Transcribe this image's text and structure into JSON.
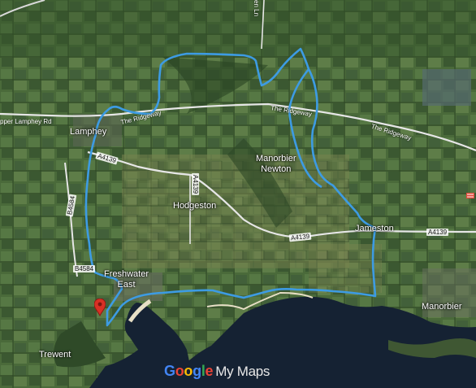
{
  "places": {
    "lamphey": "Lamphey",
    "manorbier_newton": "Manorbier\nNewton",
    "hodgeston": "Hodgeston",
    "jameston": "Jameston",
    "freshwater_east": "Freshwater\nEast",
    "trewent": "Trewent",
    "manorbier": "Manorbier"
  },
  "roads": {
    "upper_lamphey_rd": "pper Lamphey Rd",
    "ridgeway_1": "The Ridgeway",
    "ridgeway_2": "The Ridgeway",
    "ridgeway_3": "The Ridgeway",
    "a4139_1": "A4139",
    "a4139_2": "A4139",
    "a4139_3": "A4139",
    "a4139_4": "A4139",
    "b4584_1": "B4584",
    "b4584_2": "B4584",
    "top_lane": "en Ln"
  },
  "branding": {
    "g": "G",
    "o1": "o",
    "o2": "o",
    "g2": "g",
    "l": "l",
    "e": "e",
    "my_maps": "My Maps"
  },
  "colors": {
    "route": "#3d9be3",
    "pin": "#d93025",
    "sea": "#152233",
    "land": "#3c5a32"
  },
  "icons": {
    "marker": "map-pin-icon",
    "rail": "rail-icon"
  }
}
